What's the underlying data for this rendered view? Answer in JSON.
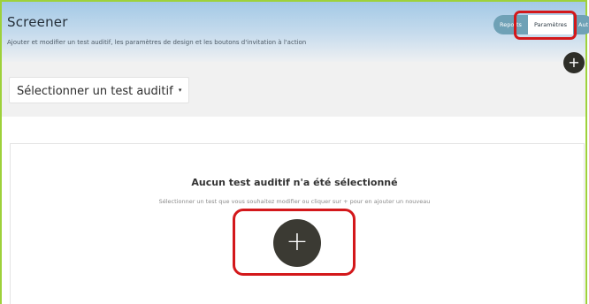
{
  "header": {
    "title": "Screener",
    "subtitle": "Ajouter et modifier un test auditif, les paramètres de design et les boutons d'invitation à l'action"
  },
  "tabs": [
    {
      "label": "Reports",
      "active": false
    },
    {
      "label": "Paramètres",
      "active": true
    },
    {
      "label": "Aut",
      "active": false
    }
  ],
  "selector": {
    "label": "Sélectionner un test auditif",
    "caret": "▾"
  },
  "add_icon": "+",
  "empty_state": {
    "title": "Aucun test auditif n'a été sélectionné",
    "description": "Sélectionner un test que vous souhaitez modifier ou cliquer sur + pour en ajouter un nouveau"
  },
  "colors": {
    "highlight": "#d3181b",
    "frame_border": "#9ed13a",
    "tab_bg": "#6fa1b6",
    "add_button": "#3b3a33"
  }
}
